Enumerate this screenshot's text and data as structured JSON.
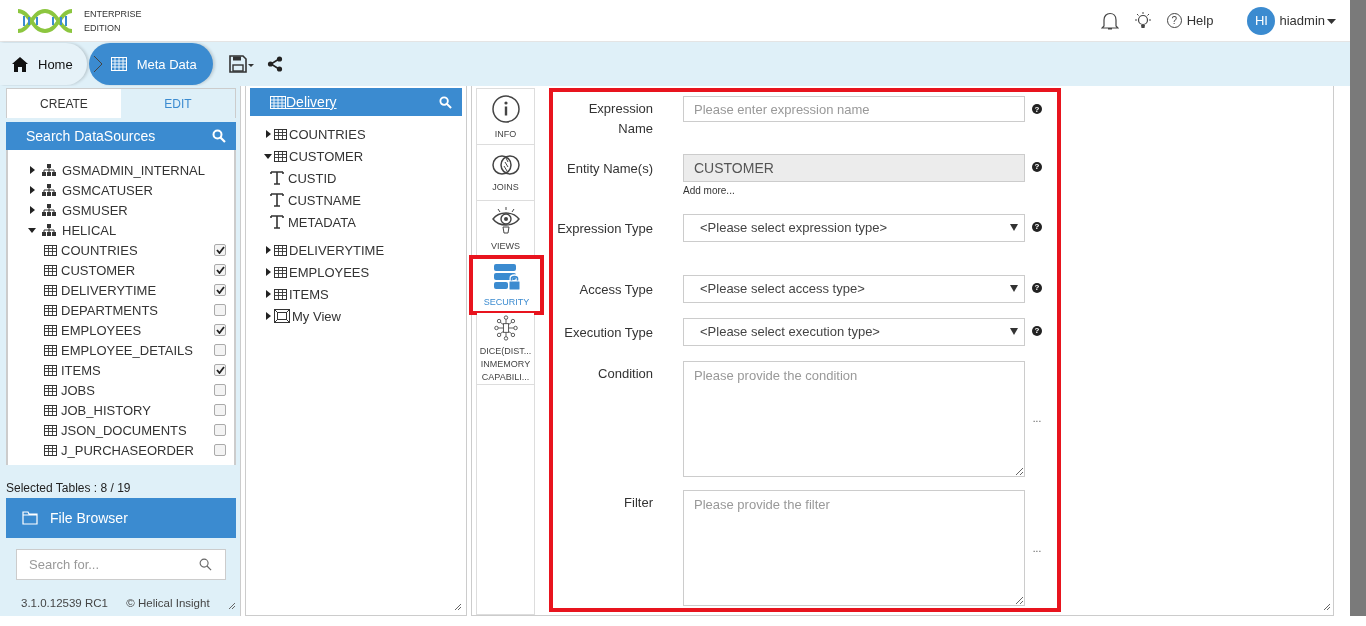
{
  "header": {
    "logo_lines": [
      "ENTERPRISE",
      "EDITION"
    ],
    "help_icon": "?",
    "help": "Help",
    "avatar": "HI",
    "user": "hiadmin"
  },
  "breadcrumb": [
    {
      "label": "Home",
      "kind": "home",
      "selected": false
    },
    {
      "label": "Meta Data",
      "kind": "grid",
      "selected": true
    }
  ],
  "left_panel": {
    "tabs": [
      {
        "label": "CREATE",
        "selected": true
      },
      {
        "label": "EDIT",
        "selected": false
      }
    ],
    "search_title": "Search DataSources",
    "tree": [
      {
        "label": "GSMADMIN_INTERNAL",
        "expanded": false
      },
      {
        "label": "GSMCATUSER",
        "expanded": false
      },
      {
        "label": "GSMUSER",
        "expanded": false
      },
      {
        "label": "HELICAL",
        "expanded": true,
        "children": [
          {
            "label": "COUNTRIES",
            "checked": true
          },
          {
            "label": "CUSTOMER",
            "checked": true
          },
          {
            "label": "DELIVERYTIME",
            "checked": true
          },
          {
            "label": "DEPARTMENTS",
            "checked": false
          },
          {
            "label": "EMPLOYEES",
            "checked": true
          },
          {
            "label": "EMPLOYEE_DETAILS",
            "checked": false
          },
          {
            "label": "ITEMS",
            "checked": true
          },
          {
            "label": "JOBS",
            "checked": false
          },
          {
            "label": "JOB_HISTORY",
            "checked": false
          },
          {
            "label": "JSON_DOCUMENTS",
            "checked": false
          },
          {
            "label": "J_PURCHASEORDER",
            "checked": false
          }
        ]
      }
    ],
    "selected_tables": "Selected Tables : 8 / 19",
    "file_browser": "File Browser",
    "search": {
      "placeholder": "Search for..."
    },
    "version": "3.1.0.12539 RC1",
    "copyright": "© Helical Insight"
  },
  "metadata_panel": {
    "title": "Delivery",
    "tree": [
      {
        "label": "COUNTRIES",
        "kind": "table",
        "expanded": false
      },
      {
        "label": "CUSTOMER",
        "kind": "table",
        "expanded": true,
        "children": [
          {
            "label": "CUSTID",
            "kind": "column"
          },
          {
            "label": "CUSTNAME",
            "kind": "column"
          },
          {
            "label": "METADATA",
            "kind": "column"
          }
        ]
      },
      {
        "label": "DELIVERYTIME",
        "kind": "table",
        "expanded": false
      },
      {
        "label": "EMPLOYEES",
        "kind": "table",
        "expanded": false
      },
      {
        "label": "ITEMS",
        "kind": "table",
        "expanded": false
      },
      {
        "label": "My View",
        "kind": "view",
        "expanded": false
      }
    ]
  },
  "side_tabs": [
    {
      "lines": [
        "INFO"
      ],
      "kind": "info",
      "selected": false
    },
    {
      "lines": [
        "JOINS"
      ],
      "kind": "joins",
      "selected": false
    },
    {
      "lines": [
        "VIEWS"
      ],
      "kind": "views",
      "selected": false
    },
    {
      "lines": [
        "SECURITY"
      ],
      "kind": "security",
      "selected": true
    },
    {
      "lines": [
        "DICE(DIST...",
        "INMEMORY",
        "CAPABILI..."
      ],
      "kind": "dice",
      "selected": false
    }
  ],
  "form": {
    "fields": [
      {
        "label": "Expression Name",
        "kind": "text",
        "placeholder": "Please enter expression name",
        "help": "?"
      },
      {
        "label": "Entity Name(s)",
        "kind": "readonly",
        "value": "CUSTOMER",
        "link": "Add more...",
        "help": "?"
      },
      {
        "label": "Expression Type",
        "kind": "select",
        "value": "<Please select expression type>",
        "help": "?"
      },
      {
        "label": "Access Type",
        "kind": "select",
        "value": "<Please select access type>",
        "help": "?"
      },
      {
        "label": "Execution Type",
        "kind": "select",
        "value": "<Please select execution type>",
        "help": "?"
      },
      {
        "label": "Condition",
        "kind": "textarea",
        "placeholder": "Please provide the condition",
        "more": "..."
      },
      {
        "label": "Filter",
        "kind": "textarea",
        "placeholder": "Please provide the filter",
        "more": "..."
      }
    ]
  }
}
